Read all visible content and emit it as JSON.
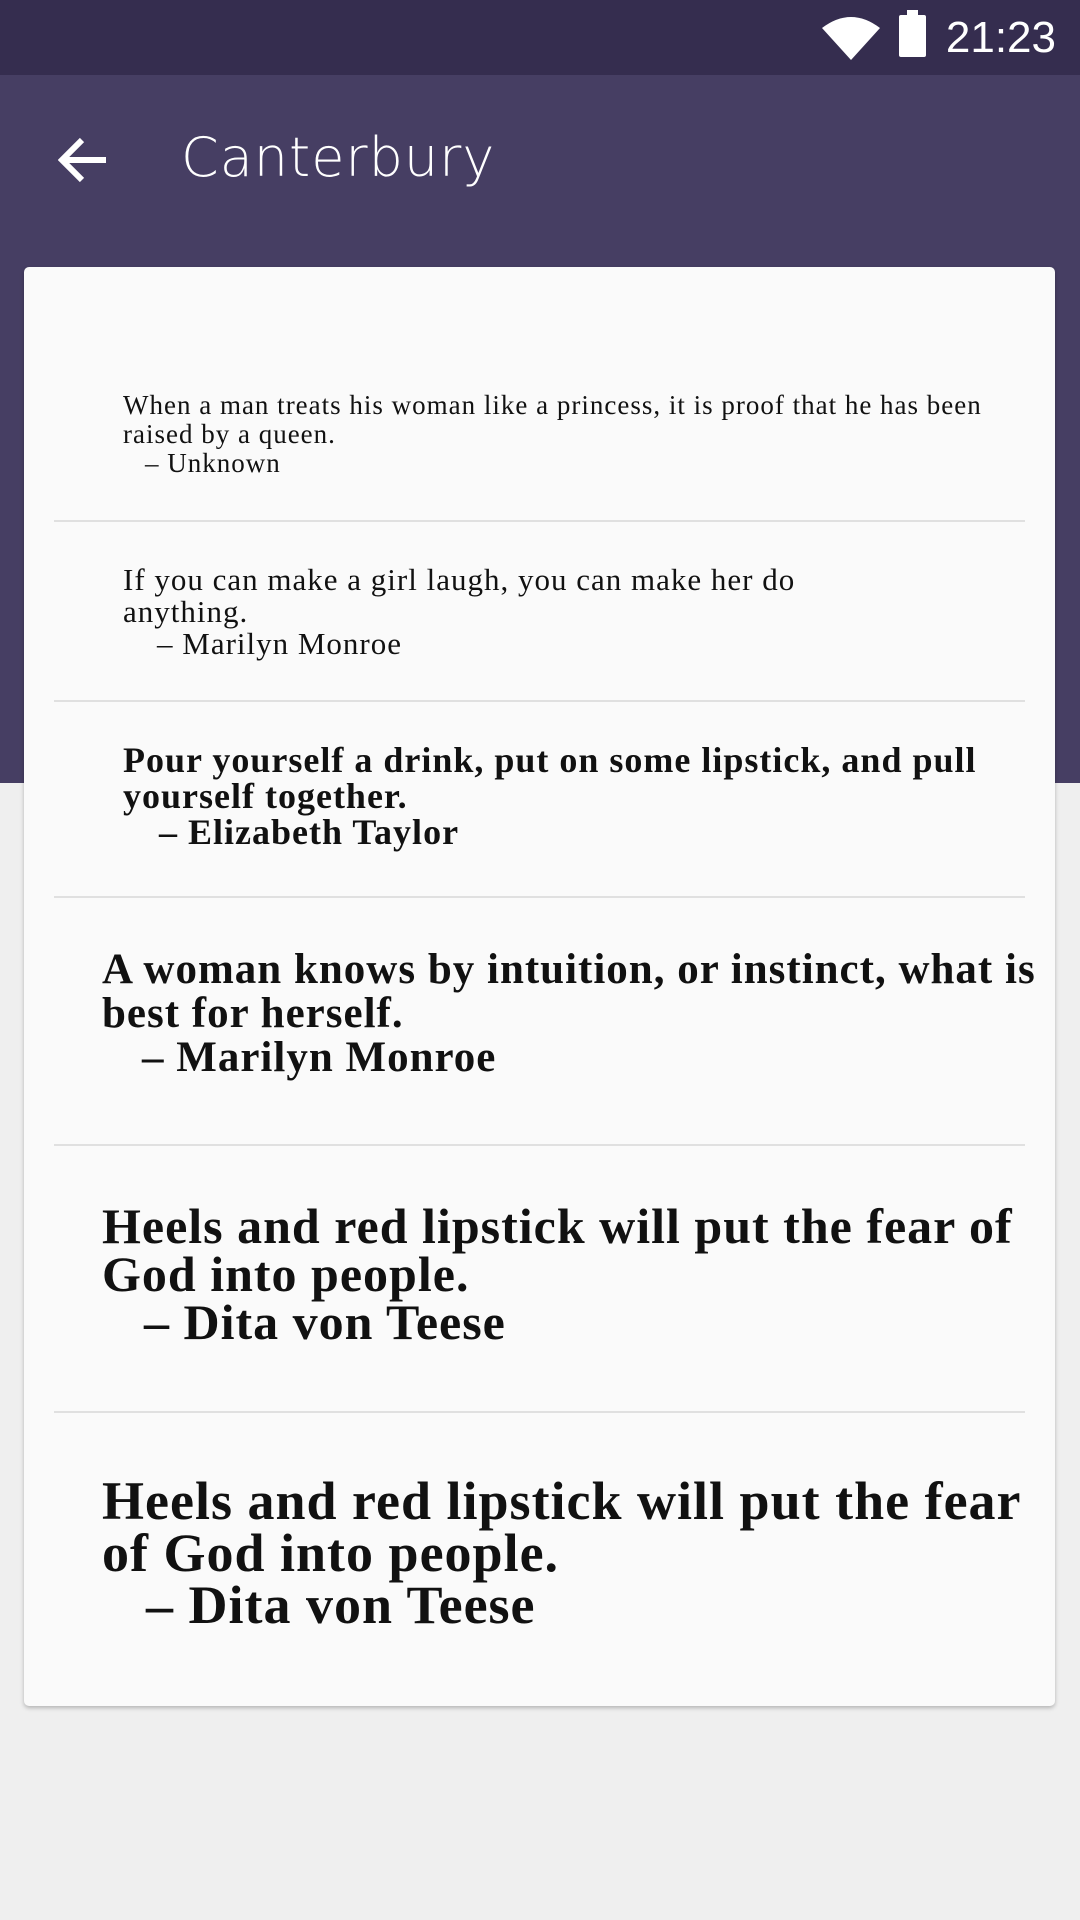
{
  "status_bar": {
    "time": "21:23",
    "icons": [
      "wifi-icon",
      "battery-icon"
    ]
  },
  "toolbar": {
    "title": "Canterbury",
    "back_icon": "arrow-left-icon"
  },
  "quotes": [
    {
      "text": "When a man treats his woman like a princess, it is proof that he has been raised by a queen.",
      "author": "– Unknown"
    },
    {
      "text": "If you can make a girl laugh, you can make her do anything.",
      "author": "– Marilyn Monroe"
    },
    {
      "text": "Pour yourself a drink, put on some lipstick, and pull yourself together.",
      "author": "– Elizabeth Taylor"
    },
    {
      "text": "A woman knows by intuition, or instinct, what is best for herself.",
      "author": "– Marilyn Monroe"
    },
    {
      "text": "Heels and red lipstick will put the fear of God into people.",
      "author": "– Dita von Teese"
    },
    {
      "text": "Heels and red lipstick will put the fear of God into people.",
      "author": "– Dita von Teese"
    }
  ],
  "colors": {
    "status_bar": "#352d4f",
    "toolbar": "#463e63",
    "card": "#fafafa",
    "background": "#efefef"
  }
}
